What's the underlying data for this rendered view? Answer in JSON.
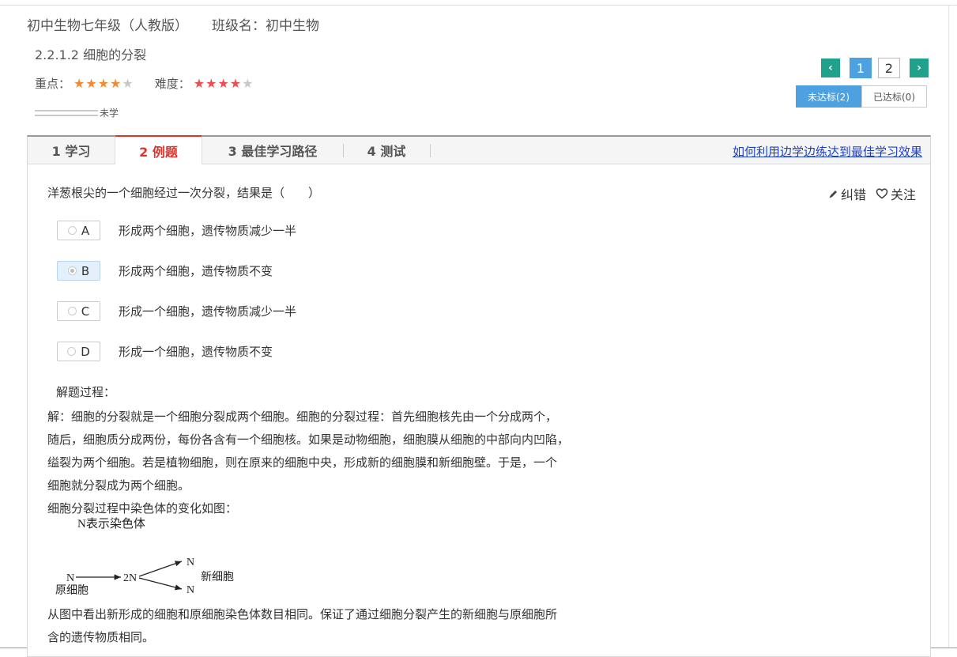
{
  "header": {
    "course": "初中生物七年级（人教版）",
    "class_name": "班级名：初中生物",
    "lesson": "2.2.1.2 细胞的分裂",
    "importance_label": "重点：",
    "importance_stars": 4,
    "difficulty_label": "难度：",
    "difficulty_stars": 4,
    "max_stars": 5,
    "progress_label": "未学",
    "progress_fraction": 0
  },
  "pager": {
    "prev": "‹",
    "next": "›",
    "pages": [
      "1",
      "2"
    ],
    "current": "1"
  },
  "status_tabs": {
    "unmet": "未达标(2)",
    "met": "已达标(0)"
  },
  "tabs": {
    "items": [
      "1 学习",
      "2 例题",
      "3 最佳学习路径",
      "4 测试"
    ],
    "active": "2 例题",
    "help_link": "如何利用边学边练达到最佳学习效果"
  },
  "question": {
    "text": "洋葱根尖的一个细胞经过一次分裂，结果是（　　）",
    "correct_label": "纠错",
    "follow_label": "关注",
    "options": [
      {
        "label": "A",
        "text": "形成两个细胞，遗传物质减少一半"
      },
      {
        "label": "B",
        "text": "形成两个细胞，遗传物质不变"
      },
      {
        "label": "C",
        "text": "形成一个细胞，遗传物质减少一半"
      },
      {
        "label": "D",
        "text": "形成一个细胞，遗传物质不变"
      }
    ],
    "selected": "B"
  },
  "solution": {
    "heading": "解题过程：",
    "paragraph1_line1": "解：细胞的分裂就是一个细胞分裂成两个细胞。细胞的分裂过程：首先细胞核先由一个分成两个，",
    "paragraph1_line2": "随后，细胞质分成两份，每份各含有一个细胞核。如果是动物细胞，细胞膜从细胞的中部向内凹陷，",
    "paragraph1_line3": "缢裂为两个细胞。若是植物细胞，则在原来的细胞中央，形成新的细胞膜和新细胞壁。于是，一个",
    "paragraph1_line4": "细胞就分裂成为两个细胞。",
    "paragraph2": "细胞分裂过程中染色体的变化如图：",
    "diagram": {
      "legend": "N表示染色体",
      "n_start": "N",
      "n_middle": "2N",
      "n_top": "N",
      "n_bottom": "N",
      "origin_label": "原细胞",
      "new_label": "新细胞"
    },
    "conclusion_line1": "从图中看出新形成的细胞和原细胞染色体数目相同。保证了通过细胞分裂产生的新细胞与原细胞所",
    "conclusion_line2": "含的遗传物质相同。"
  },
  "colors": {
    "accent_green": "#1fa18c",
    "accent_blue": "#4ea1e0",
    "active_tab_red": "#e0322a",
    "star_orange": "#f5892f",
    "star_red": "#ef4d4d",
    "link_blue": "#1a3fd0"
  }
}
